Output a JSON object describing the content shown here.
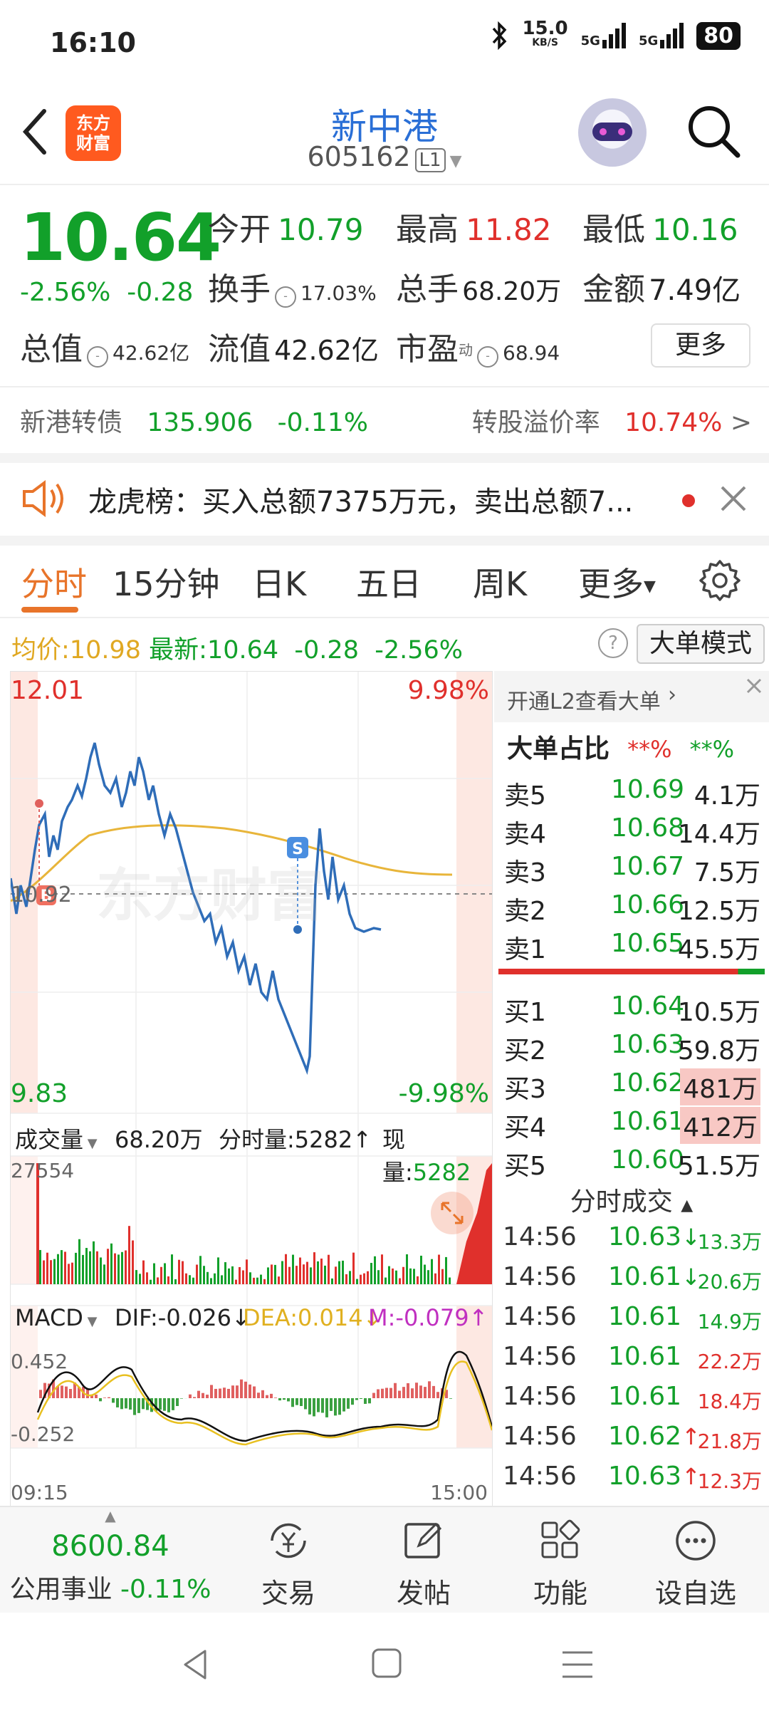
{
  "status": {
    "time": "16:10",
    "net_speed": "15.0",
    "net_unit": "KB/S",
    "sig1": "5G",
    "sig2": "5G",
    "battery": "80"
  },
  "header": {
    "logo_top": "东方",
    "logo_bottom": "财富",
    "name": "新中港",
    "code": "605162",
    "level": "L1"
  },
  "quote": {
    "price": "10.64",
    "change_pct": "-2.56%",
    "change": "-0.28",
    "open_label": "今开",
    "open": "10.79",
    "high_label": "最高",
    "high": "11.82",
    "low_label": "最低",
    "low": "10.16",
    "turnover_label": "换手",
    "turnover": "17.03%",
    "volume_label": "总手",
    "volume": "68.20万",
    "amount_label": "金额",
    "amount": "7.49亿",
    "mcap_label": "总值",
    "mcap": "42.62亿",
    "float_label": "流值",
    "float_cap": "42.62亿",
    "pe_label": "市盈",
    "pe_sup": "动",
    "pe": "68.94",
    "more": "更多"
  },
  "bond": {
    "name": "新港转债",
    "price": "135.906",
    "change": "-0.11%",
    "premium_label": "转股溢价率",
    "premium": "10.74%",
    "arrow": ">"
  },
  "notice": {
    "text": "龙虎榜：买入总额7375万元，卖出总额7..."
  },
  "tabs": [
    "分时",
    "15分钟",
    "日K",
    "五日",
    "周K",
    "更多"
  ],
  "avgbar": {
    "avg_label": "均价:",
    "avg": "10.98",
    "latest_label": "最新:",
    "latest": "10.64",
    "change": "-0.28",
    "pct": "-2.56%",
    "mode": "大单模式"
  },
  "chart": {
    "y_max": "12.01",
    "y_min": "9.83",
    "pct_max": "9.98%",
    "pct_min": "-9.98%",
    "prev_close": "10.92",
    "vol_label": "成交量",
    "vol_total": "68.20万",
    "vol_tick_label": "分时量:",
    "vol_tick": "5282",
    "vol_now_label": "现量:",
    "vol_now": "5282",
    "vol_max": "27554",
    "macd_label": "MACD",
    "dif": "DIF:-0.026",
    "dea": "DEA:0.014",
    "m": "M:-0.079",
    "macd_max": "0.452",
    "macd_min": "-0.252",
    "time_start": "09:15",
    "time_end": "15:00",
    "watermark": "东方财富"
  },
  "orderbook": {
    "l2_tip": "开通L2查看大单",
    "big_label": "大单占比",
    "big_sell": "**%",
    "big_buy": "**%",
    "asks": [
      {
        "label": "卖5",
        "price": "10.69",
        "vol": "4.1万"
      },
      {
        "label": "卖4",
        "price": "10.68",
        "vol": "14.4万"
      },
      {
        "label": "卖3",
        "price": "10.67",
        "vol": "7.5万"
      },
      {
        "label": "卖2",
        "price": "10.66",
        "vol": "12.5万"
      },
      {
        "label": "卖1",
        "price": "10.65",
        "vol": "45.5万"
      }
    ],
    "bids": [
      {
        "label": "买1",
        "price": "10.64",
        "vol": "10.5万"
      },
      {
        "label": "买2",
        "price": "10.63",
        "vol": "59.8万"
      },
      {
        "label": "买3",
        "price": "10.62",
        "vol": "481万"
      },
      {
        "label": "买4",
        "price": "10.61",
        "vol": "412万"
      },
      {
        "label": "买5",
        "price": "10.60",
        "vol": "51.5万"
      }
    ],
    "trades_title": "分时成交",
    "trades": [
      {
        "time": "14:56",
        "price": "10.63",
        "arrow": "↓",
        "vol": "13.3万",
        "color": "#12a02a"
      },
      {
        "time": "14:56",
        "price": "10.61",
        "arrow": "↓",
        "vol": "20.6万",
        "color": "#12a02a"
      },
      {
        "time": "14:56",
        "price": "10.61",
        "arrow": "",
        "vol": "14.9万",
        "color": "#12a02a"
      },
      {
        "time": "14:56",
        "price": "10.61",
        "arrow": "",
        "vol": "22.2万",
        "color": "#e0302c"
      },
      {
        "time": "14:56",
        "price": "10.61",
        "arrow": "",
        "vol": "18.4万",
        "color": "#e0302c"
      },
      {
        "time": "14:56",
        "price": "10.62",
        "arrow": "↑",
        "vol": "21.8万",
        "color": "#e0302c"
      },
      {
        "time": "14:56",
        "price": "10.63",
        "arrow": "↑",
        "vol": "12.3万",
        "color": "#e0302c"
      }
    ]
  },
  "bottom": {
    "index_value": "8600.84",
    "index_name": "公用事业",
    "index_change": "-0.11%",
    "trade": "交易",
    "post": "发帖",
    "func": "功能",
    "watch": "设自选"
  }
}
